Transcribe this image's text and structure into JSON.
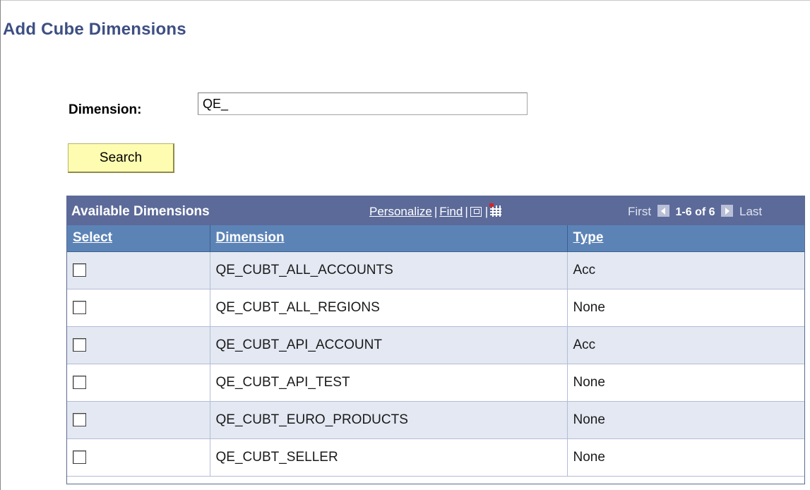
{
  "page": {
    "title": "Add Cube Dimensions"
  },
  "search": {
    "label": "Dimension:",
    "value": "QE_",
    "button_label": "Search"
  },
  "grid": {
    "title": "Available Dimensions",
    "personalize": "Personalize",
    "find": "Find",
    "separator": "|",
    "pager": {
      "first": "First",
      "range": "1-6 of 6",
      "last": "Last"
    },
    "columns": [
      "Select",
      "Dimension",
      "Type"
    ],
    "rows": [
      {
        "selected": false,
        "dimension": "QE_CUBT_ALL_ACCOUNTS",
        "type": "Acc"
      },
      {
        "selected": false,
        "dimension": "QE_CUBT_ALL_REGIONS",
        "type": "None"
      },
      {
        "selected": false,
        "dimension": "QE_CUBT_API_ACCOUNT",
        "type": "Acc"
      },
      {
        "selected": false,
        "dimension": "QE_CUBT_API_TEST",
        "type": "None"
      },
      {
        "selected": false,
        "dimension": "QE_CUBT_EURO_PRODUCTS",
        "type": "None"
      },
      {
        "selected": false,
        "dimension": "QE_CUBT_SELLER",
        "type": "None"
      }
    ]
  },
  "colors": {
    "title": "#3d4f82",
    "grid_header": "#5c6a99",
    "column_header": "#5c83b5",
    "row_alt": "#e3e8f2",
    "button": "#fdfcb1"
  },
  "icons": [
    "zoom-icon",
    "download-spreadsheet-icon",
    "prev-arrow-icon",
    "next-arrow-icon"
  ]
}
